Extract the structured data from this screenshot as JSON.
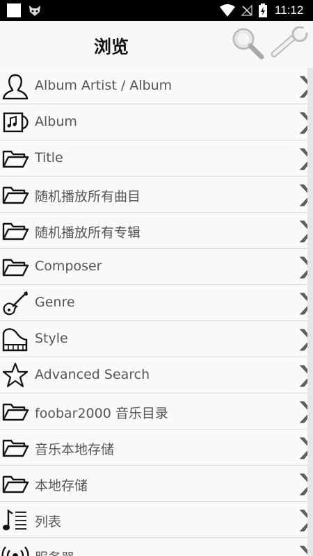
{
  "status_bar": {
    "time": "11:12"
  },
  "header": {
    "title": "浏览"
  },
  "items": [
    {
      "label": "Album Artist / Album",
      "icon": "person-icon"
    },
    {
      "label": "Album",
      "icon": "album-icon"
    },
    {
      "label": "Title",
      "icon": "folder-icon"
    },
    {
      "label": "随机播放所有曲目",
      "icon": "folder-icon"
    },
    {
      "label": "随机播放所有专辑",
      "icon": "folder-icon"
    },
    {
      "label": "Composer",
      "icon": "folder-icon"
    },
    {
      "label": "Genre",
      "icon": "guitar-icon"
    },
    {
      "label": "Style",
      "icon": "piano-icon"
    },
    {
      "label": "Advanced Search",
      "icon": "star-icon"
    },
    {
      "label": "foobar2000 音乐目录",
      "icon": "folder-icon"
    },
    {
      "label": "音乐本地存储",
      "icon": "folder-icon"
    },
    {
      "label": "本地存储",
      "icon": "folder-icon"
    },
    {
      "label": "列表",
      "icon": "playlist-icon"
    },
    {
      "label": "服务器",
      "icon": "broadcast-icon"
    }
  ]
}
